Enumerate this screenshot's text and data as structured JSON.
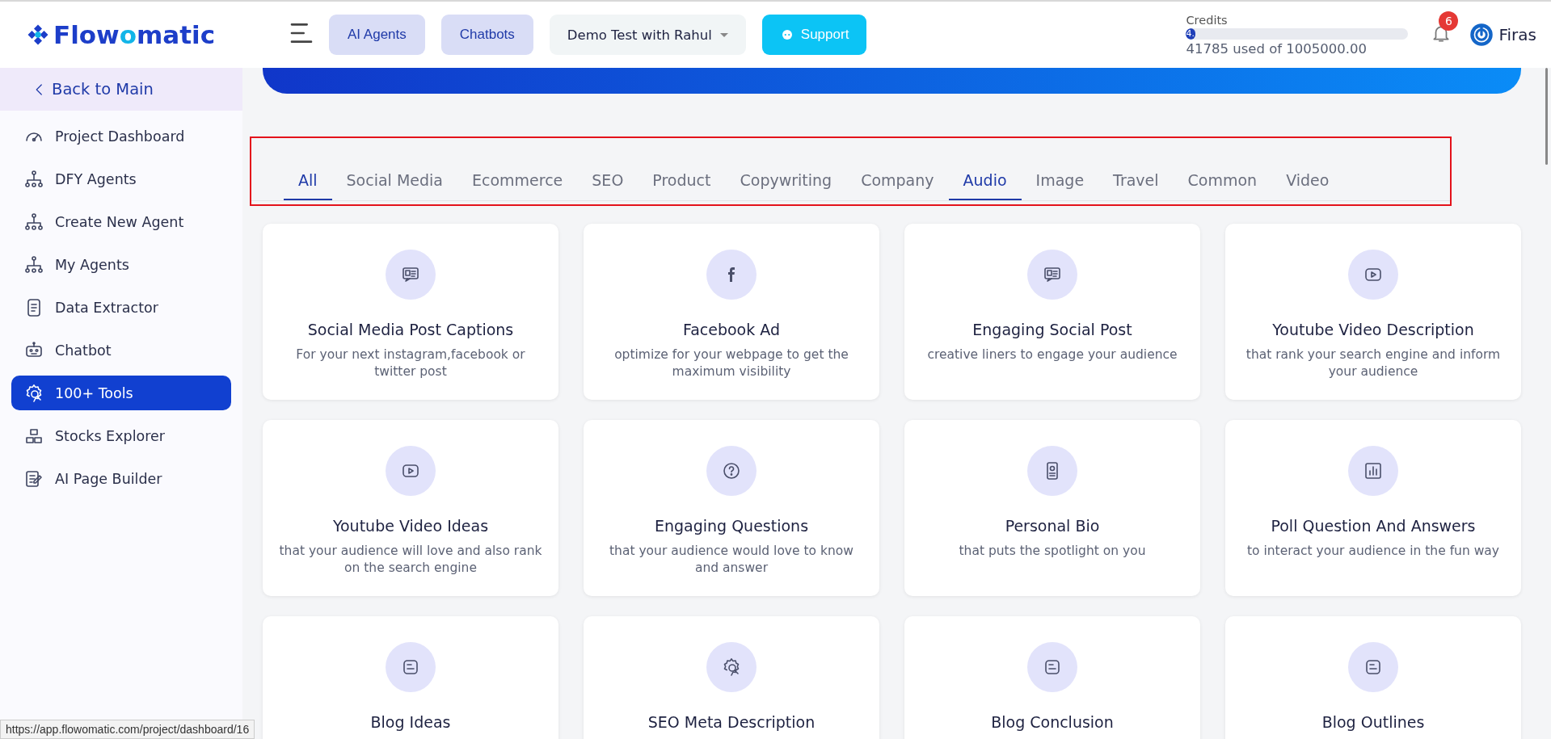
{
  "header": {
    "logo": [
      "Flow",
      "o",
      "matic"
    ],
    "nav_buttons": [
      "AI Agents",
      "Chatbots"
    ],
    "project_select": "Demo Test with Rahul",
    "support_button": "Support",
    "credits": {
      "label": "Credits",
      "level": 0.042,
      "fill_text": "4.",
      "usage": "41785 used of 1005000.00"
    },
    "notifications": "6",
    "user": "Firas"
  },
  "sidebar": {
    "back": "Back to Main",
    "items": [
      {
        "label": "Project Dashboard",
        "selected": false
      },
      {
        "label": "DFY Agents",
        "selected": false
      },
      {
        "label": "Create New Agent",
        "selected": false
      },
      {
        "label": "My Agents",
        "selected": false
      },
      {
        "label": "Data Extractor",
        "selected": false
      },
      {
        "label": "Chatbot",
        "selected": false
      },
      {
        "label": "100+ Tools",
        "selected": true
      },
      {
        "label": "Stocks Explorer",
        "selected": false
      },
      {
        "label": "AI Page Builder",
        "selected": false
      }
    ]
  },
  "tabs": [
    {
      "label": "All",
      "selected": true
    },
    {
      "label": "Social Media",
      "selected": false
    },
    {
      "label": "Ecommerce",
      "selected": false
    },
    {
      "label": "SEO",
      "selected": false
    },
    {
      "label": "Product",
      "selected": false
    },
    {
      "label": "Copywriting",
      "selected": false
    },
    {
      "label": "Company",
      "selected": false
    },
    {
      "label": "Audio",
      "selected": true
    },
    {
      "label": "Image",
      "selected": false
    },
    {
      "label": "Travel",
      "selected": false
    },
    {
      "label": "Common",
      "selected": false
    },
    {
      "label": "Video",
      "selected": false
    }
  ],
  "tools": [
    {
      "title": "Social Media Post Captions",
      "description": "For your next instagram,facebook or twitter post"
    },
    {
      "title": "Facebook Ad",
      "description": "optimize for your webpage to get the maximum visibility"
    },
    {
      "title": "Engaging Social Post",
      "description": "creative liners to engage your audience"
    },
    {
      "title": "Youtube Video Description",
      "description": "that rank your search engine and inform your audience"
    },
    {
      "title": "Youtube Video Ideas",
      "description": "that your audience will love and also rank on the search engine"
    },
    {
      "title": "Engaging Questions",
      "description": "that your audience would love to know and answer"
    },
    {
      "title": "Personal Bio",
      "description": "that puts the spotlight on you"
    },
    {
      "title": "Poll Question And Answers",
      "description": "to interact your audience in the fun way"
    },
    {
      "title": "Blog Ideas"
    },
    {
      "title": "SEO Meta Description"
    },
    {
      "title": "Blog Conclusion"
    },
    {
      "title": "Blog Outlines"
    }
  ],
  "status_url": "https://app.flowomatic.com/project/dashboard/16"
}
